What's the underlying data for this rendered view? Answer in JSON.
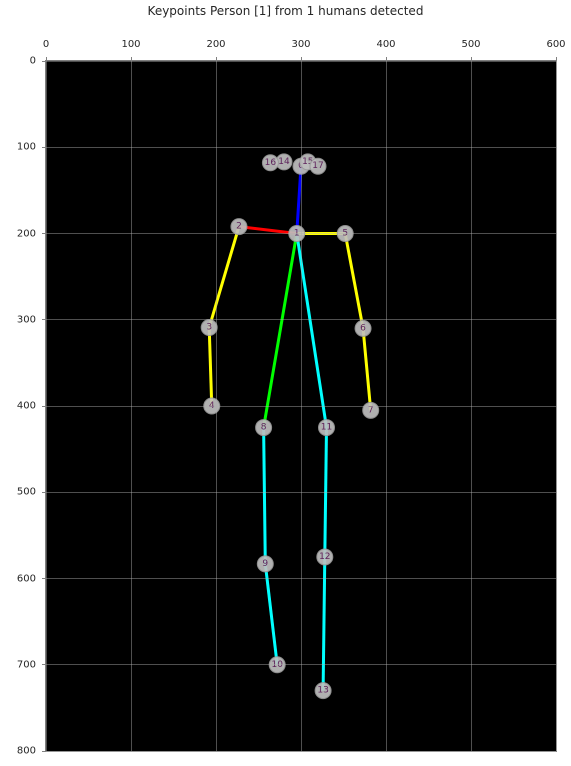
{
  "chart_data": {
    "type": "scatter",
    "title": "Keypoints Person [1] from 1 humans detected",
    "xlabel": "",
    "ylabel": "",
    "xlim": [
      0,
      600
    ],
    "ylim": [
      0,
      800
    ],
    "y_inverted": true,
    "xticks": [
      0,
      100,
      200,
      300,
      400,
      500,
      600
    ],
    "yticks": [
      0,
      100,
      200,
      300,
      400,
      500,
      600,
      700,
      800
    ],
    "keypoints": [
      {
        "id": 0,
        "x": 300,
        "y": 122
      },
      {
        "id": 1,
        "x": 295,
        "y": 200
      },
      {
        "id": 2,
        "x": 227,
        "y": 192
      },
      {
        "id": 3,
        "x": 192,
        "y": 309
      },
      {
        "id": 4,
        "x": 195,
        "y": 400
      },
      {
        "id": 5,
        "x": 352,
        "y": 200
      },
      {
        "id": 6,
        "x": 373,
        "y": 310
      },
      {
        "id": 7,
        "x": 382,
        "y": 405
      },
      {
        "id": 8,
        "x": 256,
        "y": 425
      },
      {
        "id": 9,
        "x": 258,
        "y": 583
      },
      {
        "id": 10,
        "x": 272,
        "y": 700
      },
      {
        "id": 11,
        "x": 330,
        "y": 425
      },
      {
        "id": 12,
        "x": 328,
        "y": 575
      },
      {
        "id": 13,
        "x": 326,
        "y": 730
      },
      {
        "id": 14,
        "x": 280,
        "y": 117
      },
      {
        "id": 15,
        "x": 308,
        "y": 117
      },
      {
        "id": 16,
        "x": 264,
        "y": 118
      },
      {
        "id": 17,
        "x": 320,
        "y": 122
      }
    ],
    "limbs": [
      {
        "from": 0,
        "to": 1,
        "color": "#0000ff"
      },
      {
        "from": 1,
        "to": 2,
        "color": "#ff0000"
      },
      {
        "from": 2,
        "to": 3,
        "color": "#ffff00"
      },
      {
        "from": 3,
        "to": 4,
        "color": "#ffff00"
      },
      {
        "from": 1,
        "to": 5,
        "color": "#ffff00"
      },
      {
        "from": 5,
        "to": 6,
        "color": "#ffff00"
      },
      {
        "from": 6,
        "to": 7,
        "color": "#ffff00"
      },
      {
        "from": 1,
        "to": 8,
        "color": "#00ff00"
      },
      {
        "from": 8,
        "to": 9,
        "color": "#00ffff"
      },
      {
        "from": 9,
        "to": 10,
        "color": "#00ffff"
      },
      {
        "from": 1,
        "to": 11,
        "color": "#00ffff"
      },
      {
        "from": 11,
        "to": 12,
        "color": "#00ffff"
      },
      {
        "from": 12,
        "to": 13,
        "color": "#00ffff"
      }
    ]
  }
}
